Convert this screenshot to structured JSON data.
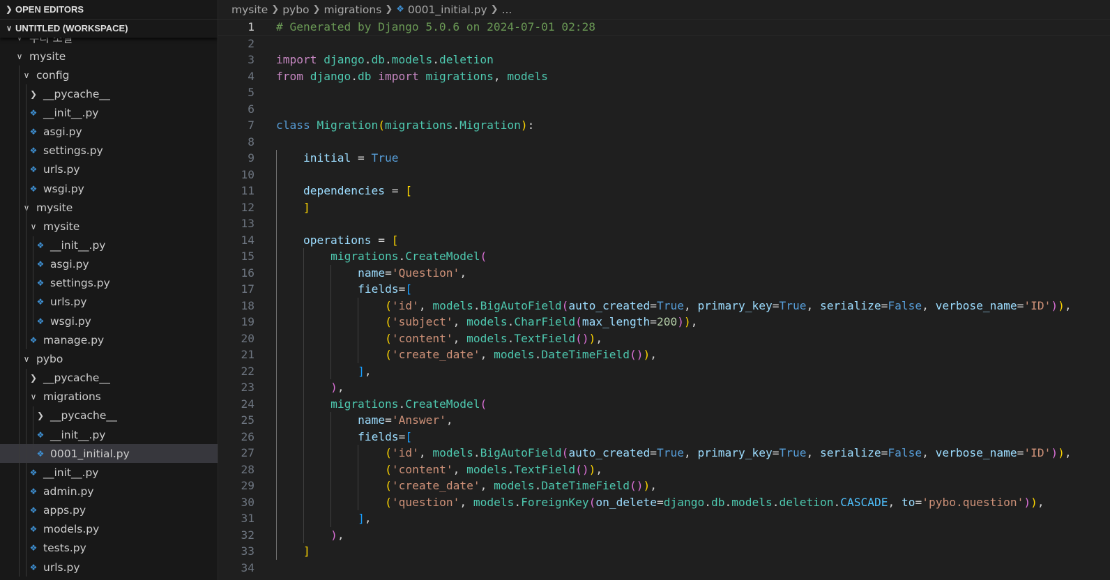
{
  "sidebar": {
    "open_editors_label": "OPEN EDITORS",
    "workspace_label": "UNTITLED (WORKSPACE)",
    "partial_root_label": "우리 소설",
    "tree": [
      {
        "label": "mysite",
        "depth": 1,
        "type": "folder-open"
      },
      {
        "label": "config",
        "depth": 2,
        "type": "folder-open"
      },
      {
        "label": "__pycache__",
        "depth": 3,
        "type": "folder-closed"
      },
      {
        "label": "__init__.py",
        "depth": 3,
        "type": "py"
      },
      {
        "label": "asgi.py",
        "depth": 3,
        "type": "py"
      },
      {
        "label": "settings.py",
        "depth": 3,
        "type": "py"
      },
      {
        "label": "urls.py",
        "depth": 3,
        "type": "py"
      },
      {
        "label": "wsgi.py",
        "depth": 3,
        "type": "py"
      },
      {
        "label": "mysite",
        "depth": 2,
        "type": "folder-open"
      },
      {
        "label": "mysite",
        "depth": 3,
        "type": "folder-open"
      },
      {
        "label": "__init__.py",
        "depth": 4,
        "type": "py"
      },
      {
        "label": "asgi.py",
        "depth": 4,
        "type": "py"
      },
      {
        "label": "settings.py",
        "depth": 4,
        "type": "py"
      },
      {
        "label": "urls.py",
        "depth": 4,
        "type": "py"
      },
      {
        "label": "wsgi.py",
        "depth": 4,
        "type": "py"
      },
      {
        "label": "manage.py",
        "depth": 3,
        "type": "py"
      },
      {
        "label": "pybo",
        "depth": 2,
        "type": "folder-open"
      },
      {
        "label": "__pycache__",
        "depth": 3,
        "type": "folder-closed"
      },
      {
        "label": "migrations",
        "depth": 3,
        "type": "folder-open"
      },
      {
        "label": "__pycache__",
        "depth": 4,
        "type": "folder-closed"
      },
      {
        "label": "__init__.py",
        "depth": 4,
        "type": "py"
      },
      {
        "label": "0001_initial.py",
        "depth": 4,
        "type": "py",
        "selected": true
      },
      {
        "label": "__init__.py",
        "depth": 3,
        "type": "py"
      },
      {
        "label": "admin.py",
        "depth": 3,
        "type": "py"
      },
      {
        "label": "apps.py",
        "depth": 3,
        "type": "py"
      },
      {
        "label": "models.py",
        "depth": 3,
        "type": "py"
      },
      {
        "label": "tests.py",
        "depth": 3,
        "type": "py"
      },
      {
        "label": "urls.py",
        "depth": 3,
        "type": "py"
      }
    ]
  },
  "breadcrumb": {
    "items": [
      "mysite",
      "pybo",
      "migrations",
      "0001_initial.py",
      "..."
    ]
  },
  "editor": {
    "current_line": 1,
    "lines": [
      {
        "n": 1,
        "indent": 0,
        "tokens": [
          [
            "cm",
            "# Generated by Django 5.0.6 on 2024-07-01 02:28"
          ]
        ]
      },
      {
        "n": 2,
        "indent": 0,
        "tokens": []
      },
      {
        "n": 3,
        "indent": 0,
        "tokens": [
          [
            "kc",
            "import"
          ],
          [
            "op",
            " "
          ],
          [
            "cls",
            "django"
          ],
          [
            "op",
            "."
          ],
          [
            "cls",
            "db"
          ],
          [
            "op",
            "."
          ],
          [
            "cls",
            "models"
          ],
          [
            "op",
            "."
          ],
          [
            "cls",
            "deletion"
          ]
        ]
      },
      {
        "n": 4,
        "indent": 0,
        "tokens": [
          [
            "kc",
            "from"
          ],
          [
            "op",
            " "
          ],
          [
            "cls",
            "django"
          ],
          [
            "op",
            "."
          ],
          [
            "cls",
            "db"
          ],
          [
            "op",
            " "
          ],
          [
            "kc",
            "import"
          ],
          [
            "op",
            " "
          ],
          [
            "cls",
            "migrations"
          ],
          [
            "op",
            ", "
          ],
          [
            "cls",
            "models"
          ]
        ]
      },
      {
        "n": 5,
        "indent": 0,
        "tokens": []
      },
      {
        "n": 6,
        "indent": 0,
        "tokens": []
      },
      {
        "n": 7,
        "indent": 0,
        "tokens": [
          [
            "kw",
            "class"
          ],
          [
            "op",
            " "
          ],
          [
            "cls",
            "Migration"
          ],
          [
            "b1",
            "("
          ],
          [
            "cls",
            "migrations"
          ],
          [
            "op",
            "."
          ],
          [
            "cls",
            "Migration"
          ],
          [
            "b1",
            ")"
          ],
          [
            "op",
            ":"
          ]
        ]
      },
      {
        "n": 8,
        "indent": 0,
        "tokens": []
      },
      {
        "n": 9,
        "indent": 1,
        "tokens": [
          [
            "var",
            "initial"
          ],
          [
            "op",
            " = "
          ],
          [
            "kw",
            "True"
          ]
        ]
      },
      {
        "n": 10,
        "indent": 0,
        "tokens": []
      },
      {
        "n": 11,
        "indent": 1,
        "tokens": [
          [
            "var",
            "dependencies"
          ],
          [
            "op",
            " = "
          ],
          [
            "b1",
            "["
          ]
        ]
      },
      {
        "n": 12,
        "indent": 1,
        "tokens": [
          [
            "b1",
            "]"
          ]
        ]
      },
      {
        "n": 13,
        "indent": 0,
        "tokens": []
      },
      {
        "n": 14,
        "indent": 1,
        "tokens": [
          [
            "var",
            "operations"
          ],
          [
            "op",
            " = "
          ],
          [
            "b1",
            "["
          ]
        ]
      },
      {
        "n": 15,
        "indent": 2,
        "tokens": [
          [
            "cls",
            "migrations"
          ],
          [
            "op",
            "."
          ],
          [
            "cls",
            "CreateModel"
          ],
          [
            "b2",
            "("
          ]
        ]
      },
      {
        "n": 16,
        "indent": 3,
        "tokens": [
          [
            "var",
            "name"
          ],
          [
            "op",
            "="
          ],
          [
            "str",
            "'Question'"
          ],
          [
            "op",
            ","
          ]
        ]
      },
      {
        "n": 17,
        "indent": 3,
        "tokens": [
          [
            "var",
            "fields"
          ],
          [
            "op",
            "="
          ],
          [
            "b3",
            "["
          ]
        ]
      },
      {
        "n": 18,
        "indent": 4,
        "tokens": [
          [
            "b1",
            "("
          ],
          [
            "str",
            "'id'"
          ],
          [
            "op",
            ", "
          ],
          [
            "cls",
            "models"
          ],
          [
            "op",
            "."
          ],
          [
            "cls",
            "BigAutoField"
          ],
          [
            "b2",
            "("
          ],
          [
            "var",
            "auto_created"
          ],
          [
            "op",
            "="
          ],
          [
            "kw",
            "True"
          ],
          [
            "op",
            ", "
          ],
          [
            "var",
            "primary_key"
          ],
          [
            "op",
            "="
          ],
          [
            "kw",
            "True"
          ],
          [
            "op",
            ", "
          ],
          [
            "var",
            "serialize"
          ],
          [
            "op",
            "="
          ],
          [
            "kw",
            "False"
          ],
          [
            "op",
            ", "
          ],
          [
            "var",
            "verbose_name"
          ],
          [
            "op",
            "="
          ],
          [
            "str",
            "'ID'"
          ],
          [
            "b2",
            ")"
          ],
          [
            "b1",
            ")"
          ],
          [
            "op",
            ","
          ]
        ]
      },
      {
        "n": 19,
        "indent": 4,
        "tokens": [
          [
            "b1",
            "("
          ],
          [
            "str",
            "'subject'"
          ],
          [
            "op",
            ", "
          ],
          [
            "cls",
            "models"
          ],
          [
            "op",
            "."
          ],
          [
            "cls",
            "CharField"
          ],
          [
            "b2",
            "("
          ],
          [
            "var",
            "max_length"
          ],
          [
            "op",
            "="
          ],
          [
            "num",
            "200"
          ],
          [
            "b2",
            ")"
          ],
          [
            "b1",
            ")"
          ],
          [
            "op",
            ","
          ]
        ]
      },
      {
        "n": 20,
        "indent": 4,
        "tokens": [
          [
            "b1",
            "("
          ],
          [
            "str",
            "'content'"
          ],
          [
            "op",
            ", "
          ],
          [
            "cls",
            "models"
          ],
          [
            "op",
            "."
          ],
          [
            "cls",
            "TextField"
          ],
          [
            "b2",
            "()"
          ],
          [
            "b1",
            ")"
          ],
          [
            "op",
            ","
          ]
        ]
      },
      {
        "n": 21,
        "indent": 4,
        "tokens": [
          [
            "b1",
            "("
          ],
          [
            "str",
            "'create_date'"
          ],
          [
            "op",
            ", "
          ],
          [
            "cls",
            "models"
          ],
          [
            "op",
            "."
          ],
          [
            "cls",
            "DateTimeField"
          ],
          [
            "b2",
            "()"
          ],
          [
            "b1",
            ")"
          ],
          [
            "op",
            ","
          ]
        ]
      },
      {
        "n": 22,
        "indent": 3,
        "tokens": [
          [
            "b3",
            "]"
          ],
          [
            "op",
            ","
          ]
        ]
      },
      {
        "n": 23,
        "indent": 2,
        "tokens": [
          [
            "b2",
            ")"
          ],
          [
            "op",
            ","
          ]
        ]
      },
      {
        "n": 24,
        "indent": 2,
        "tokens": [
          [
            "cls",
            "migrations"
          ],
          [
            "op",
            "."
          ],
          [
            "cls",
            "CreateModel"
          ],
          [
            "b2",
            "("
          ]
        ]
      },
      {
        "n": 25,
        "indent": 3,
        "tokens": [
          [
            "var",
            "name"
          ],
          [
            "op",
            "="
          ],
          [
            "str",
            "'Answer'"
          ],
          [
            "op",
            ","
          ]
        ]
      },
      {
        "n": 26,
        "indent": 3,
        "tokens": [
          [
            "var",
            "fields"
          ],
          [
            "op",
            "="
          ],
          [
            "b3",
            "["
          ]
        ]
      },
      {
        "n": 27,
        "indent": 4,
        "tokens": [
          [
            "b1",
            "("
          ],
          [
            "str",
            "'id'"
          ],
          [
            "op",
            ", "
          ],
          [
            "cls",
            "models"
          ],
          [
            "op",
            "."
          ],
          [
            "cls",
            "BigAutoField"
          ],
          [
            "b2",
            "("
          ],
          [
            "var",
            "auto_created"
          ],
          [
            "op",
            "="
          ],
          [
            "kw",
            "True"
          ],
          [
            "op",
            ", "
          ],
          [
            "var",
            "primary_key"
          ],
          [
            "op",
            "="
          ],
          [
            "kw",
            "True"
          ],
          [
            "op",
            ", "
          ],
          [
            "var",
            "serialize"
          ],
          [
            "op",
            "="
          ],
          [
            "kw",
            "False"
          ],
          [
            "op",
            ", "
          ],
          [
            "var",
            "verbose_name"
          ],
          [
            "op",
            "="
          ],
          [
            "str",
            "'ID'"
          ],
          [
            "b2",
            ")"
          ],
          [
            "b1",
            ")"
          ],
          [
            "op",
            ","
          ]
        ]
      },
      {
        "n": 28,
        "indent": 4,
        "tokens": [
          [
            "b1",
            "("
          ],
          [
            "str",
            "'content'"
          ],
          [
            "op",
            ", "
          ],
          [
            "cls",
            "models"
          ],
          [
            "op",
            "."
          ],
          [
            "cls",
            "TextField"
          ],
          [
            "b2",
            "()"
          ],
          [
            "b1",
            ")"
          ],
          [
            "op",
            ","
          ]
        ]
      },
      {
        "n": 29,
        "indent": 4,
        "tokens": [
          [
            "b1",
            "("
          ],
          [
            "str",
            "'create_date'"
          ],
          [
            "op",
            ", "
          ],
          [
            "cls",
            "models"
          ],
          [
            "op",
            "."
          ],
          [
            "cls",
            "DateTimeField"
          ],
          [
            "b2",
            "()"
          ],
          [
            "b1",
            ")"
          ],
          [
            "op",
            ","
          ]
        ]
      },
      {
        "n": 30,
        "indent": 4,
        "tokens": [
          [
            "b1",
            "("
          ],
          [
            "str",
            "'question'"
          ],
          [
            "op",
            ", "
          ],
          [
            "cls",
            "models"
          ],
          [
            "op",
            "."
          ],
          [
            "cls",
            "ForeignKey"
          ],
          [
            "b2",
            "("
          ],
          [
            "var",
            "on_delete"
          ],
          [
            "op",
            "="
          ],
          [
            "cls",
            "django"
          ],
          [
            "op",
            "."
          ],
          [
            "cls",
            "db"
          ],
          [
            "op",
            "."
          ],
          [
            "cls",
            "models"
          ],
          [
            "op",
            "."
          ],
          [
            "cls",
            "deletion"
          ],
          [
            "op",
            "."
          ],
          [
            "cn",
            "CASCADE"
          ],
          [
            "op",
            ", "
          ],
          [
            "var",
            "to"
          ],
          [
            "op",
            "="
          ],
          [
            "str",
            "'pybo.question'"
          ],
          [
            "b2",
            ")"
          ],
          [
            "b1",
            ")"
          ],
          [
            "op",
            ","
          ]
        ]
      },
      {
        "n": 31,
        "indent": 3,
        "tokens": [
          [
            "b3",
            "]"
          ],
          [
            "op",
            ","
          ]
        ]
      },
      {
        "n": 32,
        "indent": 2,
        "tokens": [
          [
            "b2",
            ")"
          ],
          [
            "op",
            ","
          ]
        ]
      },
      {
        "n": 33,
        "indent": 1,
        "tokens": [
          [
            "b1",
            "]"
          ]
        ]
      },
      {
        "n": 34,
        "indent": 0,
        "tokens": []
      }
    ]
  },
  "colors": {
    "background": "#1f1f1f",
    "sidebar": "#181818",
    "selection": "#37373d",
    "python_icon": "#3e8fd1"
  }
}
